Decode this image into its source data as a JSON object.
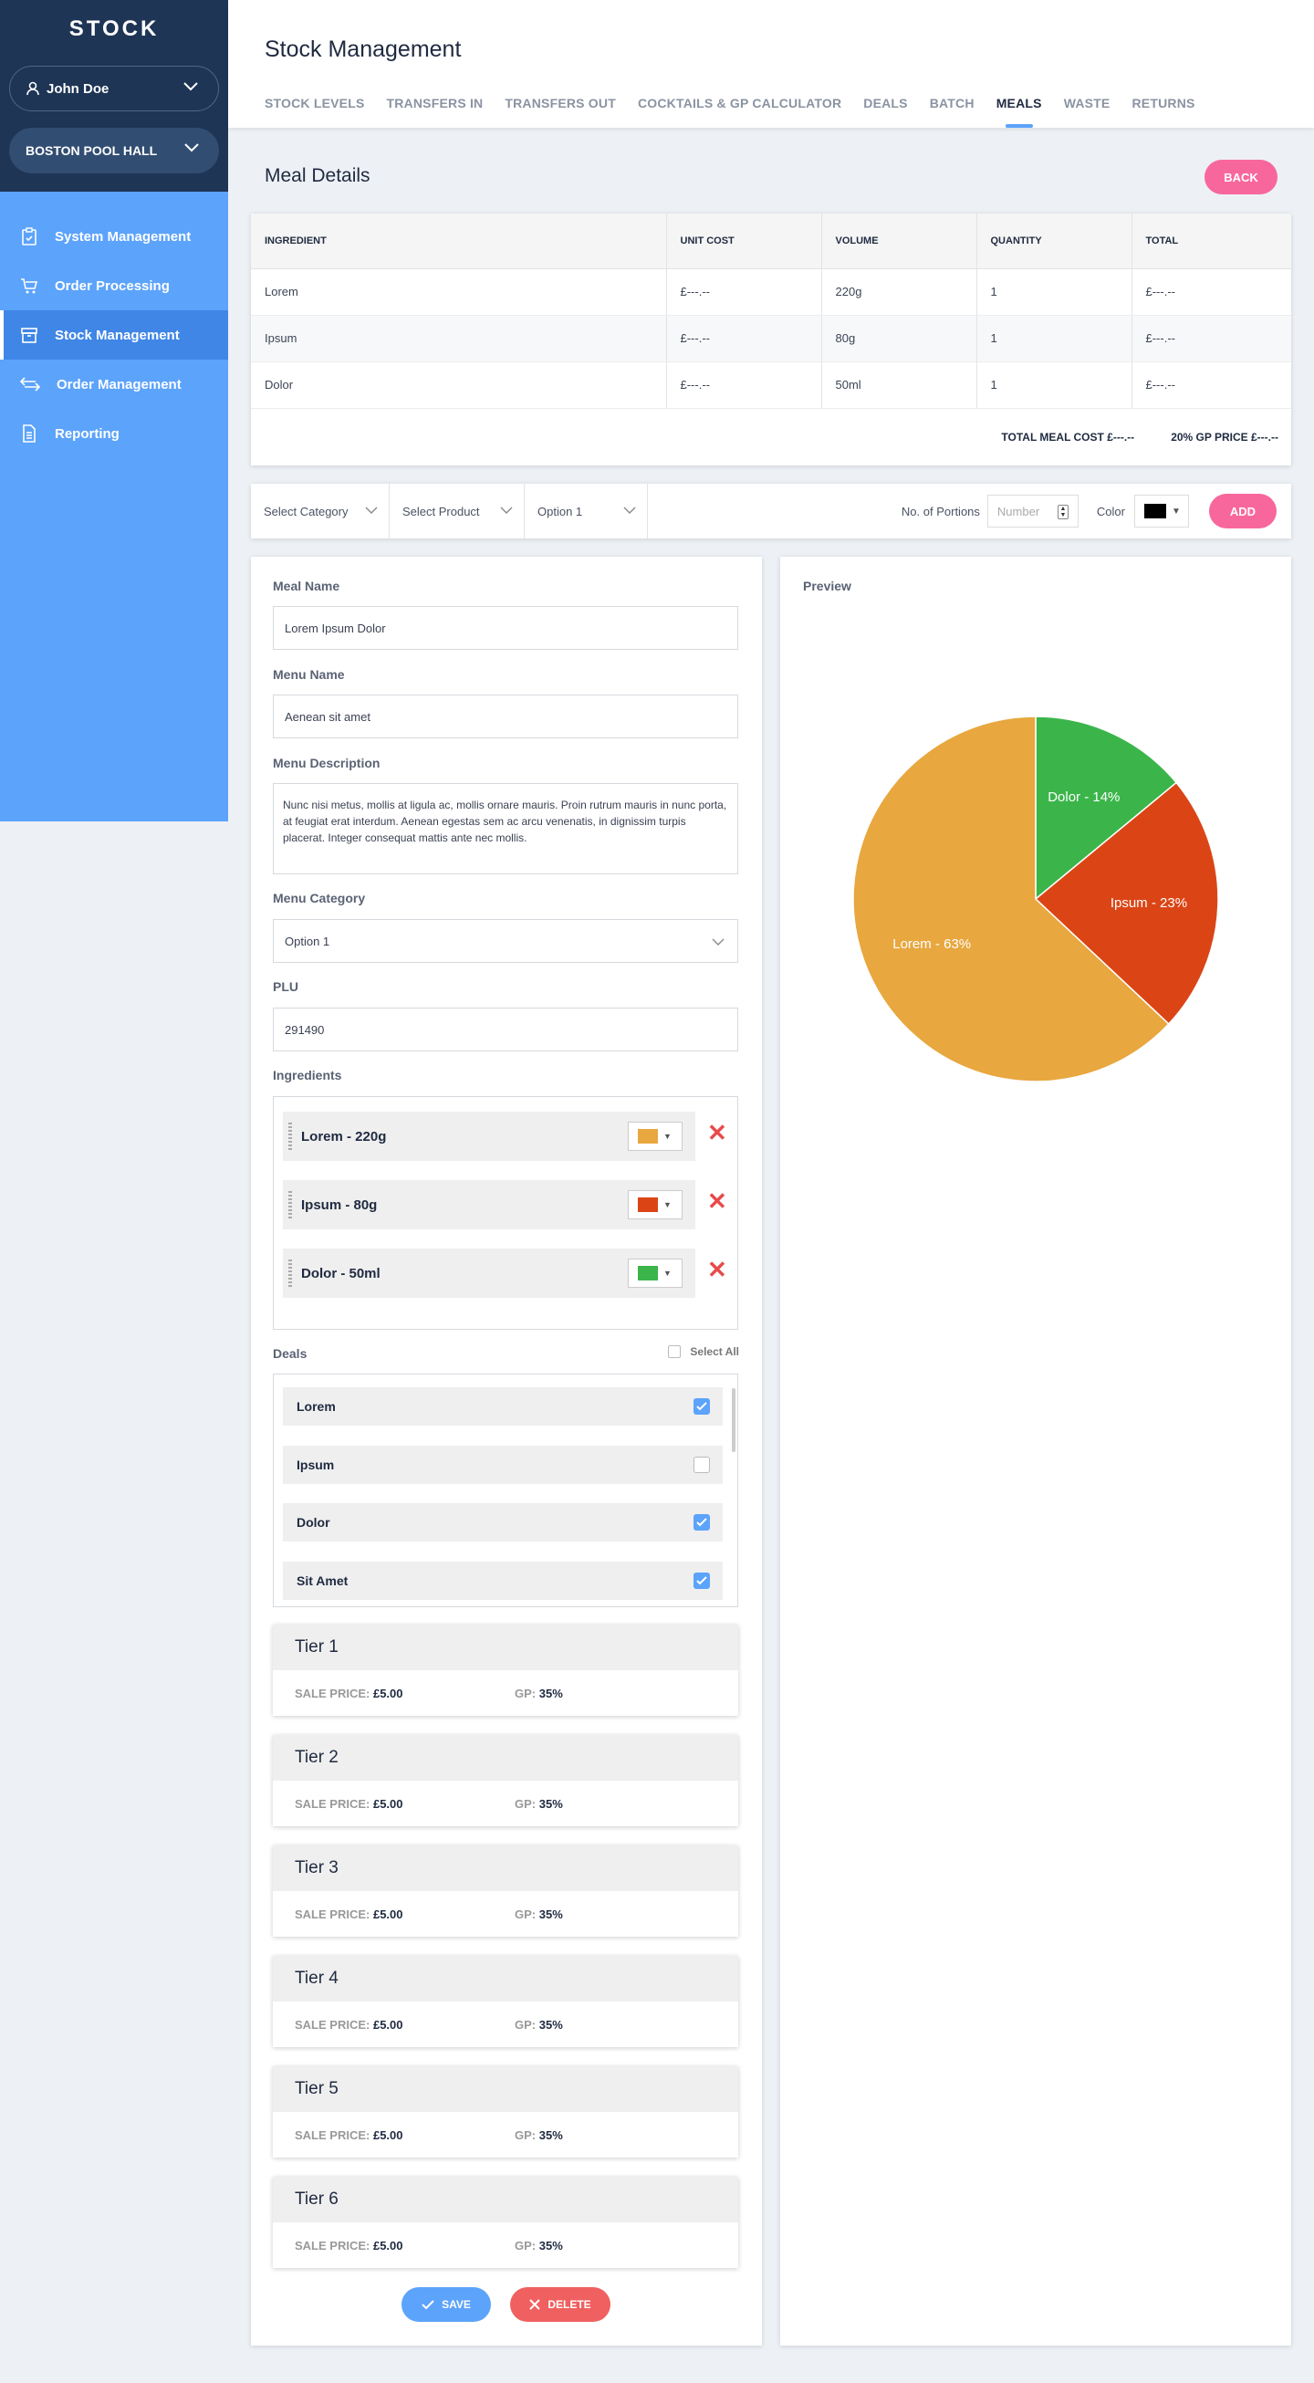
{
  "sidebar": {
    "logo": "STOCK",
    "user": "John Doe",
    "venue": "BOSTON POOL HALL",
    "items": [
      {
        "label": "System Management",
        "icon": "clipboard-icon"
      },
      {
        "label": "Order Processing",
        "icon": "cart-icon"
      },
      {
        "label": "Stock Management",
        "icon": "box-icon",
        "active": true
      },
      {
        "label": "Order Management",
        "icon": "arrows-icon"
      },
      {
        "label": "Reporting",
        "icon": "document-icon"
      }
    ]
  },
  "header": {
    "title": "Stock Management",
    "tabs": [
      "STOCK LEVELS",
      "TRANSFERS IN",
      "TRANSFERS OUT",
      "COCKTAILS & GP CALCULATOR",
      "DEALS",
      "BATCH",
      "MEALS",
      "WASTE",
      "RETURNS"
    ],
    "active_tab": "MEALS"
  },
  "meal_details": {
    "title": "Meal Details",
    "back_label": "BACK",
    "columns": [
      "INGREDIENT",
      "UNIT COST",
      "VOLUME",
      "QUANTITY",
      "TOTAL"
    ],
    "rows": [
      [
        "Lorem",
        "£---.--",
        "220g",
        "1",
        "£---.--"
      ],
      [
        "Ipsum",
        "£---.--",
        "80g",
        "1",
        "£---.--"
      ],
      [
        "Dolor",
        "£---.--",
        "50ml",
        "1",
        "£---.--"
      ]
    ],
    "total_meal_cost": "TOTAL MEAL COST £---.--",
    "gp_price": "20% GP PRICE £---.--"
  },
  "filters": {
    "category": "Select Category",
    "product": "Select Product",
    "option": "Option 1",
    "portions_label": "No. of Portions",
    "portions_placeholder": "Number",
    "color_label": "Color",
    "color_value": "#000000",
    "add_label": "ADD"
  },
  "form": {
    "meal_name_label": "Meal Name",
    "meal_name": "Lorem Ipsum Dolor",
    "menu_name_label": "Menu Name",
    "menu_name": "Aenean sit amet",
    "menu_description_label": "Menu Description",
    "menu_description": "Nunc nisi metus, mollis at ligula ac, mollis ornare mauris. Proin rutrum mauris in nunc porta, at feugiat erat interdum. Aenean egestas sem ac arcu venenatis, in dignissim turpis placerat. Integer consequat mattis ante nec mollis.",
    "menu_category_label": "Menu Category",
    "menu_category": "Option 1",
    "plu_label": "PLU",
    "plu": "291490",
    "ingredients_label": "Ingredients",
    "ingredients": [
      {
        "label": "Lorem - 220g",
        "color": "#e8a73f"
      },
      {
        "label": "Ipsum - 80g",
        "color": "#db4516"
      },
      {
        "label": "Dolor - 50ml",
        "color": "#3bb54a"
      }
    ],
    "deals_label": "Deals",
    "select_all_label": "Select All",
    "deals": [
      {
        "label": "Lorem",
        "checked": true
      },
      {
        "label": "Ipsum",
        "checked": false
      },
      {
        "label": "Dolor",
        "checked": true
      },
      {
        "label": "Sit Amet",
        "checked": true
      }
    ],
    "tiers": [
      {
        "name": "Tier 1",
        "sale_label": "SALE PRICE:",
        "sale_price": "£5.00",
        "gp_label": "GP:",
        "gp": "35%"
      },
      {
        "name": "Tier 2",
        "sale_label": "SALE PRICE:",
        "sale_price": "£5.00",
        "gp_label": "GP:",
        "gp": "35%"
      },
      {
        "name": "Tier 3",
        "sale_label": "SALE PRICE:",
        "sale_price": "£5.00",
        "gp_label": "GP:",
        "gp": "35%"
      },
      {
        "name": "Tier 4",
        "sale_label": "SALE PRICE:",
        "sale_price": "£5.00",
        "gp_label": "GP:",
        "gp": "35%"
      },
      {
        "name": "Tier 5",
        "sale_label": "SALE PRICE:",
        "sale_price": "£5.00",
        "gp_label": "GP:",
        "gp": "35%"
      },
      {
        "name": "Tier 6",
        "sale_label": "SALE PRICE:",
        "sale_price": "£5.00",
        "gp_label": "GP:",
        "gp": "35%"
      }
    ],
    "save_label": "SAVE",
    "delete_label": "DELETE"
  },
  "preview": {
    "title": "Preview"
  },
  "chart_data": {
    "type": "pie",
    "title": "",
    "slices": [
      {
        "label": "Dolor - 14%",
        "value": 14,
        "color": "#3bb54a"
      },
      {
        "label": "Ipsum - 23%",
        "value": 23,
        "color": "#db4516"
      },
      {
        "label": "Lorem - 63%",
        "value": 63,
        "color": "#e8a73f"
      }
    ]
  },
  "colors": {
    "accent": "#5ca3fb",
    "pink": "#f8679b",
    "danger": "#f06060",
    "sidebar_dark": "#1e3555"
  }
}
